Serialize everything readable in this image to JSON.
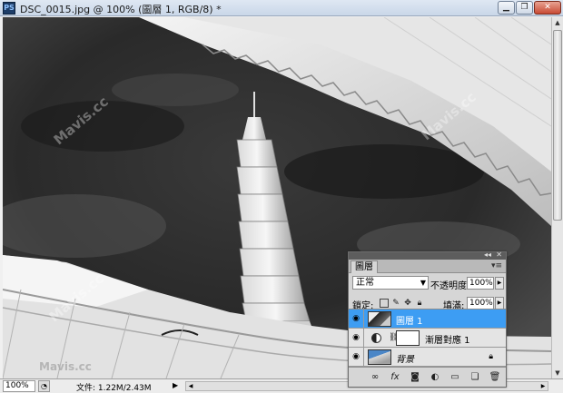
{
  "window": {
    "app_icon": "PS",
    "doc_title": "DSC_0015.jpg @ 100% (圖層 1, RGB/8) *",
    "minimize_label": "▁",
    "restore_label": "❐",
    "close_label": "✕"
  },
  "canvas": {
    "watermarks": [
      "Mavis.cc",
      "Mavis.cc",
      "Mavis.cc",
      "Mavis.cc"
    ]
  },
  "statusbar": {
    "zoom": "100%",
    "doc_info": "文件: 1.22M/2.43M",
    "info_arrow": "▶"
  },
  "layers_panel": {
    "collapse_label": "◂◂",
    "close_label": "✕",
    "tab_label": "圖層",
    "menu_icon": "▾≡",
    "blend_mode": "正常",
    "opacity_label": "不透明度:",
    "opacity_value": "100%",
    "lock_label": "鎖定:",
    "fill_label": "填滿:",
    "fill_value": "100%",
    "layers": [
      {
        "name": "圖層 1",
        "selected": true
      },
      {
        "name": "漸層對應 1",
        "selected": false
      },
      {
        "name": "背景",
        "selected": false,
        "locked": true
      }
    ],
    "footer_icons": [
      "link-icon",
      "fx-icon",
      "mask-icon",
      "adjustment-icon",
      "group-icon",
      "new-layer-icon",
      "trash-icon"
    ]
  },
  "colors": {
    "selection": "#3d9df3",
    "panel_bg": "#d6d6d6",
    "titlebar": "#c9d7e8"
  }
}
